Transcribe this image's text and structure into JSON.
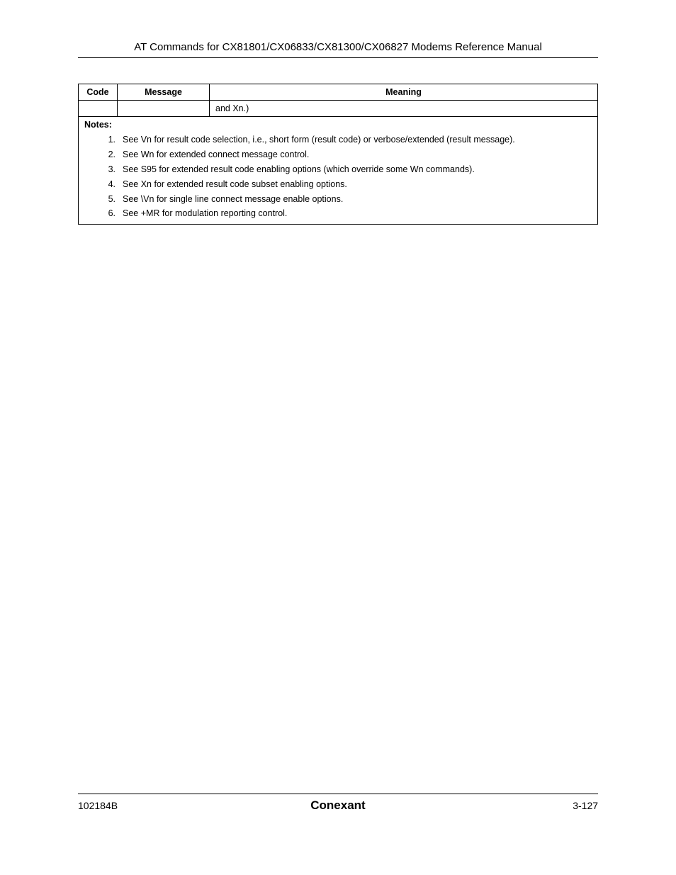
{
  "header": {
    "title": "AT Commands for CX81801/CX06833/CX81300/CX06827 Modems Reference Manual"
  },
  "table": {
    "headers": {
      "code": "Code",
      "message": "Message",
      "meaning": "Meaning"
    },
    "row": {
      "code": "",
      "message": "",
      "meaning": "and Xn.)"
    },
    "notes_label": "Notes:",
    "notes": [
      {
        "n": "1.",
        "t": "See Vn for result code selection, i.e., short form (result code) or verbose/extended (result message)."
      },
      {
        "n": "2.",
        "t": "See Wn for extended connect message control."
      },
      {
        "n": "3.",
        "t": "See S95 for extended result code enabling options (which override some Wn commands)."
      },
      {
        "n": "4.",
        "t": "See Xn for extended result code subset enabling options."
      },
      {
        "n": "5.",
        "t": "See \\Vn for single line connect message enable options."
      },
      {
        "n": "6.",
        "t": "See +MR for modulation reporting control."
      }
    ]
  },
  "footer": {
    "left": "102184B",
    "center": "Conexant",
    "right": "3-127"
  }
}
